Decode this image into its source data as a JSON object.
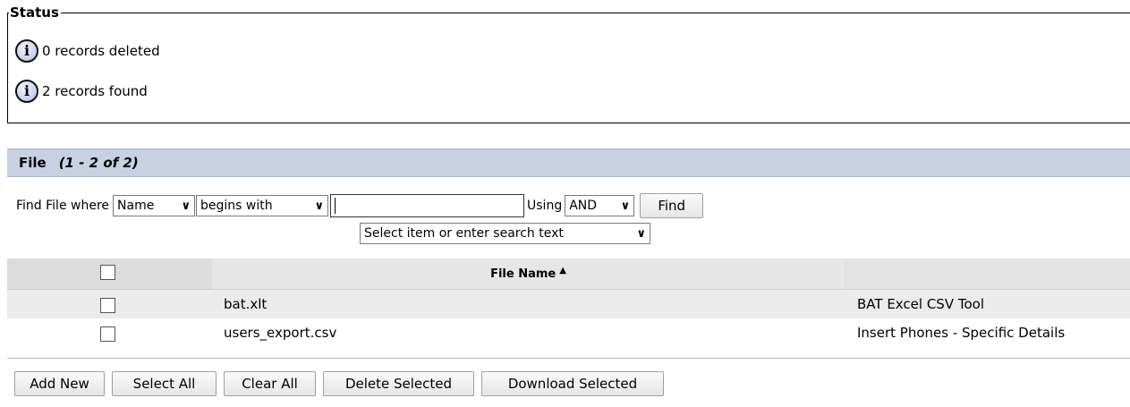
{
  "status": {
    "legend": "Status",
    "messages": [
      "0 records deleted",
      "2 records found"
    ],
    "icon": "info-icon"
  },
  "section": {
    "title": "File",
    "count": "(1 - 2 of 2)"
  },
  "find": {
    "label": "Find File where",
    "field_select": "Name",
    "operator_select": "begins with",
    "search_value": "",
    "using_label": "Using",
    "logic_select": "AND",
    "find_button": "Find",
    "hint_select": "Select item or enter search text"
  },
  "table": {
    "columns": [
      "",
      "File Name",
      ""
    ],
    "sort_indicator": "▲",
    "rows": [
      {
        "file_name": "bat.xlt",
        "description": "BAT Excel CSV Tool",
        "checked": false
      },
      {
        "file_name": "users_export.csv",
        "description": "Insert Phones - Specific Details",
        "checked": false
      }
    ]
  },
  "buttons": {
    "add_new": "Add New",
    "select_all": "Select All",
    "clear_all": "Clear All",
    "delete_selected": "Delete Selected",
    "download_selected": "Download Selected"
  },
  "colors": {
    "section_bar": "#c8d0e2",
    "header_row": "#dcdcdc",
    "odd_row": "#ebebeb"
  }
}
